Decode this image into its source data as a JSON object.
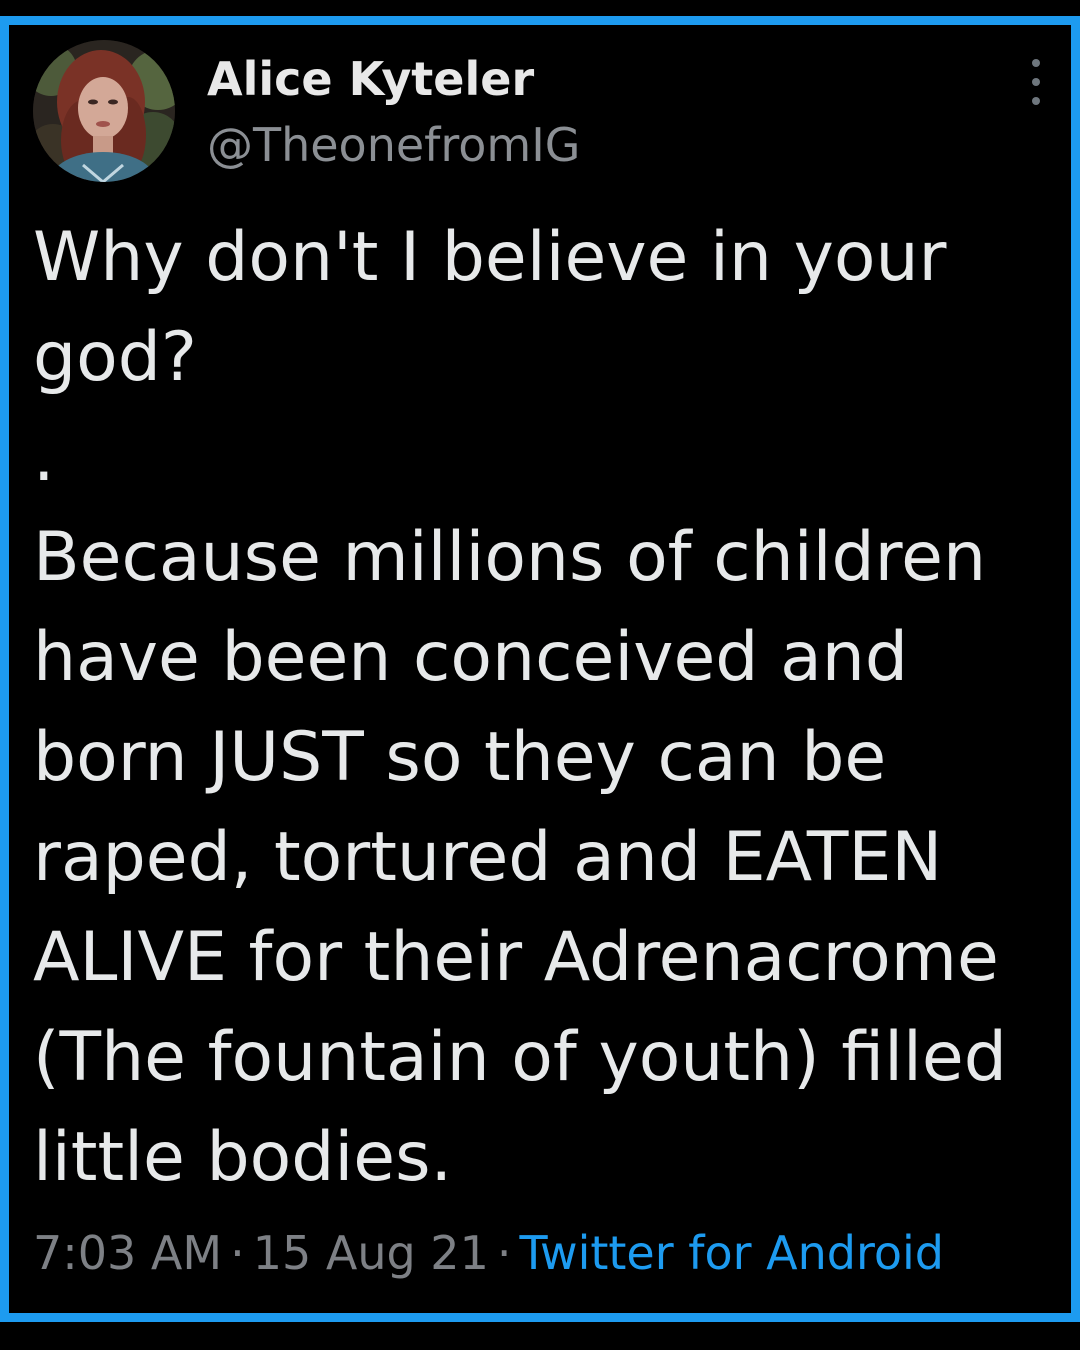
{
  "tweet": {
    "author": {
      "display_name": "Alice Kyteler",
      "handle": "@TheonefromIG",
      "avatar": "profile-photo"
    },
    "text": "Why don't I believe in your god?\n.\nBecause millions of children have been conceived and born JUST so they can be raped, tortured and EATEN ALIVE for their Adrenacrome (The fountain of youth) filled little bodies.",
    "time": "7:03 AM",
    "date": "15 Aug 21",
    "separator": "·",
    "source": "Twitter for Android",
    "more_icon": "more-vertical-icon"
  },
  "colors": {
    "background": "#000000",
    "frame_border": "#1d9bf0",
    "text": "#e7e9ea",
    "muted": "#7d8085",
    "link": "#1d9bf0"
  }
}
